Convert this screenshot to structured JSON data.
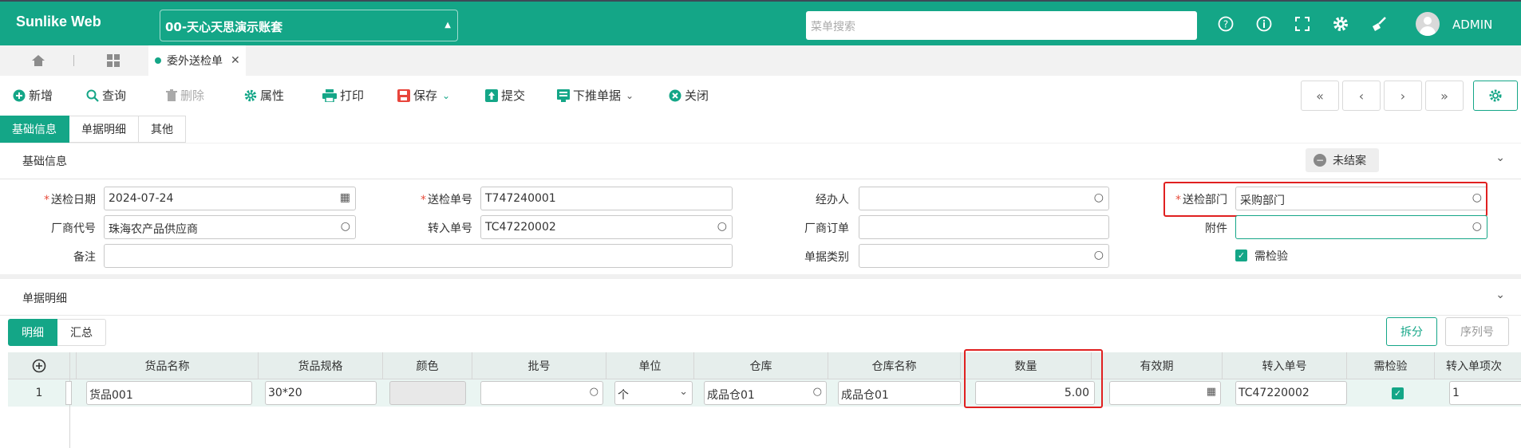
{
  "header": {
    "brand": "Sunlike Web",
    "account": "00-天心天思演示账套",
    "search_placeholder": "菜单搜索",
    "user": "ADMIN",
    "icons": [
      "help-icon",
      "info-icon",
      "fullscreen-icon",
      "settings-icon",
      "clean-icon"
    ]
  },
  "tabs": {
    "active": "委外送检单"
  },
  "toolbar": {
    "new": "新增",
    "query": "查询",
    "delete": "删除",
    "props": "属性",
    "print": "打印",
    "save": "保存",
    "submit": "提交",
    "push": "下推单据",
    "close": "关闭"
  },
  "section_tabs": [
    "基础信息",
    "单据明细",
    "其他"
  ],
  "basic": {
    "title": "基础信息",
    "status": "未结案",
    "fields": {
      "send_date_label": "送检日期",
      "send_date": "2024-07-24",
      "send_no_label": "送检单号",
      "send_no": "T747240001",
      "handler_label": "经办人",
      "handler": "",
      "dept_label": "送检部门",
      "dept": "采购部门",
      "vendor_label": "厂商代号",
      "vendor": "珠海农产品供应商",
      "transfer_no_label": "转入单号",
      "transfer_no": "TC47220002",
      "vendor_order_label": "厂商订单",
      "vendor_order": "",
      "attach_label": "附件",
      "attach": "",
      "remark_label": "备注",
      "remark": "",
      "doc_type_label": "单据类别",
      "doc_type": "",
      "need_inspect_label": "需检验",
      "need_inspect": true
    }
  },
  "detail": {
    "title": "单据明细",
    "tabs": [
      "明细",
      "汇总"
    ],
    "split": "拆分",
    "serial": "序列号",
    "columns": [
      "货品名称",
      "货品规格",
      "颜色",
      "批号",
      "单位",
      "仓库",
      "仓库名称",
      "数量",
      "有效期",
      "转入单号",
      "需检验",
      "转入单项次"
    ],
    "rows": [
      {
        "no": "1",
        "name": "货品001",
        "spec": "30*20",
        "color": "",
        "batch": "",
        "unit": "个",
        "wh": "成品仓01",
        "wh_name": "成品仓01",
        "qty": "5.00",
        "expire": "",
        "transfer": "TC47220002",
        "inspect": true,
        "item": "1"
      }
    ]
  }
}
